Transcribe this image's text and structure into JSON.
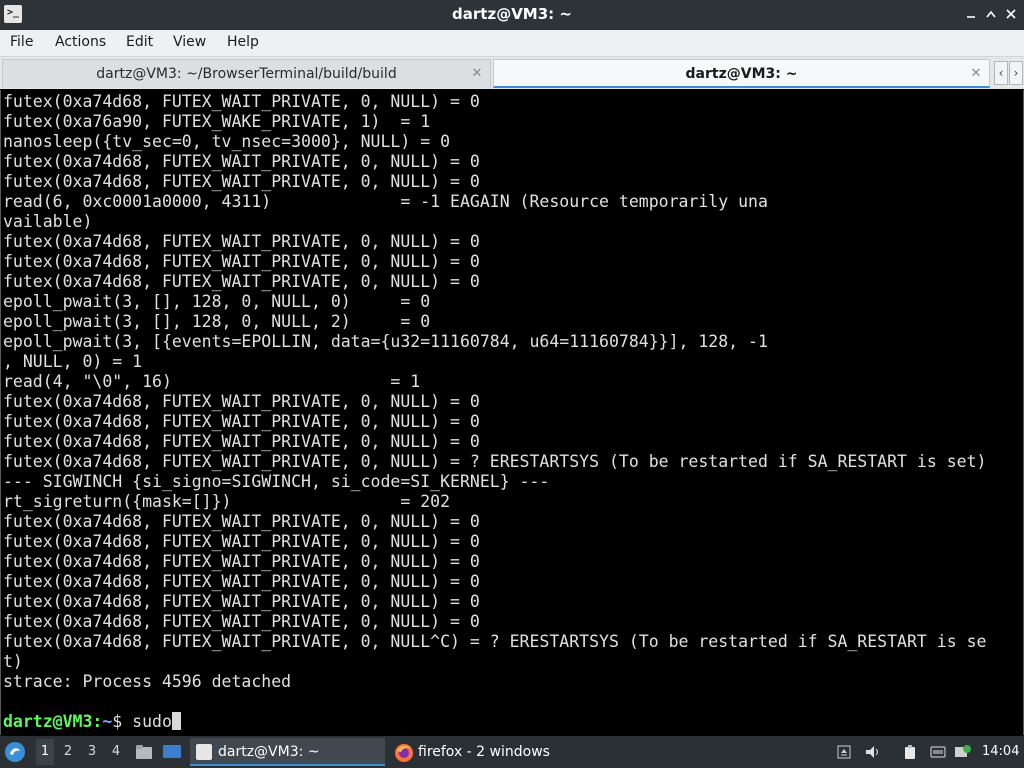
{
  "window": {
    "title": "dartz@VM3: ~",
    "app_icon_glyph": ">_"
  },
  "menu": [
    "File",
    "Actions",
    "Edit",
    "View",
    "Help"
  ],
  "tabs": [
    {
      "label": "dartz@VM3: ~/BrowserTerminal/build/build",
      "active": false
    },
    {
      "label": "dartz@VM3: ~",
      "active": true
    }
  ],
  "terminal": {
    "lines": [
      "futex(0xa74d68, FUTEX_WAIT_PRIVATE, 0, NULL) = 0",
      "futex(0xa76a90, FUTEX_WAKE_PRIVATE, 1)  = 1",
      "nanosleep({tv_sec=0, tv_nsec=3000}, NULL) = 0",
      "futex(0xa74d68, FUTEX_WAIT_PRIVATE, 0, NULL) = 0",
      "futex(0xa74d68, FUTEX_WAIT_PRIVATE, 0, NULL) = 0",
      "read(6, 0xc0001a0000, 4311)             = -1 EAGAIN (Resource temporarily una",
      "vailable)",
      "futex(0xa74d68, FUTEX_WAIT_PRIVATE, 0, NULL) = 0",
      "futex(0xa74d68, FUTEX_WAIT_PRIVATE, 0, NULL) = 0",
      "futex(0xa74d68, FUTEX_WAIT_PRIVATE, 0, NULL) = 0",
      "epoll_pwait(3, [], 128, 0, NULL, 0)     = 0",
      "epoll_pwait(3, [], 128, 0, NULL, 2)     = 0",
      "epoll_pwait(3, [{events=EPOLLIN, data={u32=11160784, u64=11160784}}], 128, -1",
      ", NULL, 0) = 1",
      "read(4, \"\\0\", 16)                      = 1",
      "futex(0xa74d68, FUTEX_WAIT_PRIVATE, 0, NULL) = 0",
      "futex(0xa74d68, FUTEX_WAIT_PRIVATE, 0, NULL) = 0",
      "futex(0xa74d68, FUTEX_WAIT_PRIVATE, 0, NULL) = 0",
      "futex(0xa74d68, FUTEX_WAIT_PRIVATE, 0, NULL) = ? ERESTARTSYS (To be restarted if SA_RESTART is set)",
      "--- SIGWINCH {si_signo=SIGWINCH, si_code=SI_KERNEL} ---",
      "rt_sigreturn({mask=[]})                 = 202",
      "futex(0xa74d68, FUTEX_WAIT_PRIVATE, 0, NULL) = 0",
      "futex(0xa74d68, FUTEX_WAIT_PRIVATE, 0, NULL) = 0",
      "futex(0xa74d68, FUTEX_WAIT_PRIVATE, 0, NULL) = 0",
      "futex(0xa74d68, FUTEX_WAIT_PRIVATE, 0, NULL) = 0",
      "futex(0xa74d68, FUTEX_WAIT_PRIVATE, 0, NULL) = 0",
      "futex(0xa74d68, FUTEX_WAIT_PRIVATE, 0, NULL) = 0",
      "futex(0xa74d68, FUTEX_WAIT_PRIVATE, 0, NULL^C) = ? ERESTARTSYS (To be restarted if SA_RESTART is se",
      "t)",
      "strace: Process 4596 detached",
      ""
    ],
    "prompt": {
      "user_host": "dartz@VM3",
      "separator": ":",
      "path": "~",
      "symbol": "$ ",
      "input": "sudo"
    }
  },
  "taskbar": {
    "workspaces": [
      "1",
      "2",
      "3",
      "4"
    ],
    "active_workspace": "1",
    "tasks": [
      {
        "label": "dartz@VM3: ~",
        "icon": "terminal-icon",
        "active": true
      },
      {
        "label": "firefox - 2 windows",
        "icon": "firefox-icon",
        "active": false
      }
    ],
    "clock": "14:04"
  },
  "colors": {
    "terminal_bg": "#000000",
    "terminal_fg": "#e0e0e0",
    "prompt_user": "#5ff55f",
    "prompt_path": "#7da6ff",
    "accent": "#3b8fd6",
    "titlebar_bg": "#2e3338",
    "taskbar_bg": "#2b3035"
  }
}
